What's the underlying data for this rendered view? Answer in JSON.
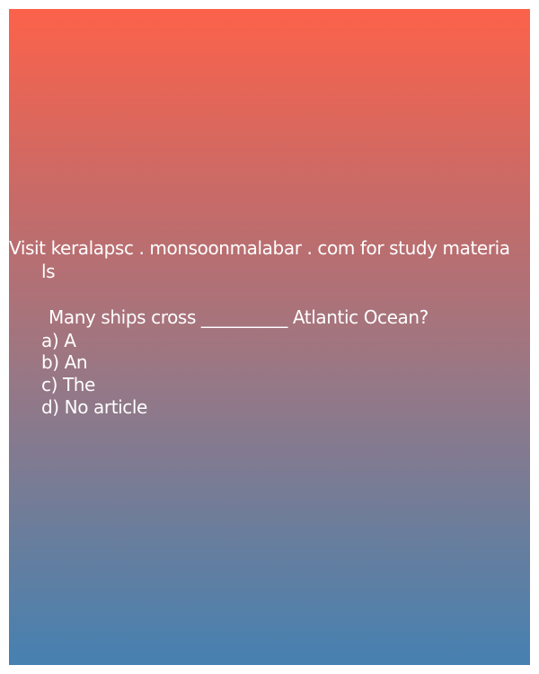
{
  "visit_line_1": "Visit keralapsc . monsoonmalabar . com for study materia",
  "visit_line_2": "ls",
  "question": "Many ships cross __________ Atlantic Ocean?",
  "options": [
    "a) A",
    "b) An",
    "c) The",
    "d) No article"
  ],
  "colors": {
    "gradient_top": "#fc624a",
    "gradient_bottom": "#4681b1",
    "text": "#ffffff"
  }
}
